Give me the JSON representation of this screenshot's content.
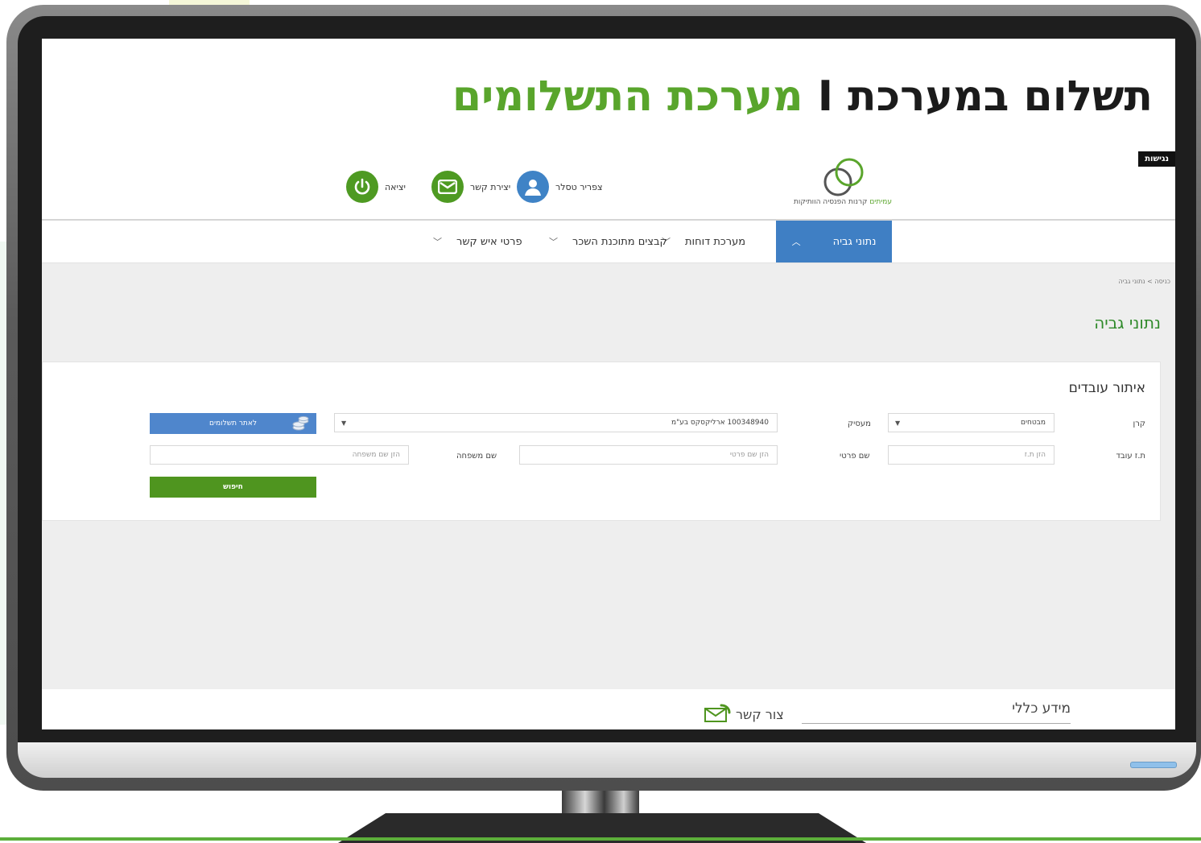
{
  "headline": {
    "part1": "תשלום במערכת",
    "separator": "I",
    "part2": "מערכת התשלומים"
  },
  "accessibility": "נגישות",
  "logo": {
    "green_text": "עמיתים",
    "text": "קרנות הפנסיה הוותיקות"
  },
  "header": {
    "user_name": "צפריר טסלר",
    "contact": "יצירת קשר",
    "logout": "יציאה"
  },
  "nav": {
    "items": [
      {
        "label": "נתוני גביה"
      },
      {
        "label": "מערכת דוחות"
      },
      {
        "label": "קבצים מתוכנת השכר"
      },
      {
        "label": "פרטי איש קשר"
      }
    ]
  },
  "breadcrumb": "כניסה > נתוני גביה",
  "page_title": "נתוני גביה",
  "search": {
    "title": "איתור עובדים",
    "fund_label": "קרן",
    "fund_value": "מבטחים",
    "employer_label": "מעסיק",
    "employer_value": "100348940 ארליקסקס בע\"מ",
    "pay_button": "לאתר תשלומים",
    "id_label": "ת.ז עובד",
    "id_placeholder": "הזן ת.ז",
    "firstname_label": "שם פרטי",
    "firstname_placeholder": "הזן שם פרטי",
    "lastname_label": "שם משפחה",
    "lastname_placeholder": "הזן שם משפחה",
    "search_button": "חיפוש"
  },
  "footer": {
    "info": "מידע כללי",
    "contact": "צור קשר"
  }
}
